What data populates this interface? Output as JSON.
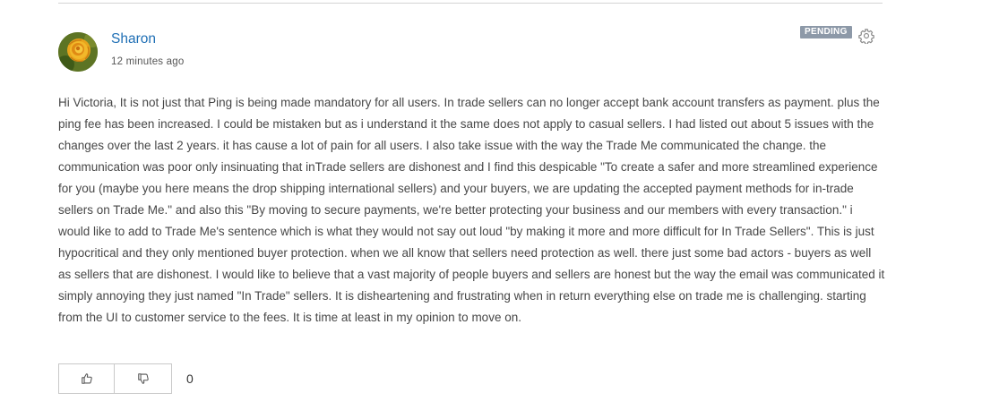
{
  "post": {
    "author": "Sharon",
    "timestamp": "12 minutes ago",
    "status": "PENDING",
    "body": "Hi Victoria, It is not just that Ping is being made mandatory for all users. In trade sellers can no longer accept bank account transfers as payment. plus the ping fee has been increased. I could be mistaken but as i understand it the same does not apply to casual sellers. I had listed out about 5 issues with the changes over the last 2 years. it has cause a lot of pain for all users. I also take issue with the way the Trade Me communicated the change. the communication was poor only insinuating that inTrade sellers are dishonest and I find this despicable \"To create a safer and more streamlined experience for you (maybe you here means the drop shipping international sellers) and your buyers, we are updating the accepted payment methods for in-trade sellers on Trade Me.\" and also this \"By moving to secure payments, we're better protecting your business and our members with every transaction.\" i would like to add to Trade Me's sentence which is what they would not say out loud \"by making it more and more difficult for In Trade Sellers\". This is just hypocritical and they only mentioned buyer protection. when we all know that sellers need protection as well. there just some bad actors - buyers as well as sellers that are dishonest. I would like to believe that a vast majority of people buyers and sellers are honest but the way the email was communicated it simply annoying they just named \"In Trade\" sellers. It is disheartening and frustrating when in return everything else on trade me is challenging. starting from the UI to customer service to the fees. It is time at least in my opinion to move on.",
    "vote_count": "0"
  },
  "icons": {
    "settings": "gear-icon",
    "upvote": "thumbs-up-icon",
    "downvote": "thumbs-down-icon",
    "avatar": "rose-flower-avatar"
  },
  "colors": {
    "author_link": "#1f6fb5",
    "badge_bg": "#8d99a8",
    "body_text": "#474747",
    "divider": "#d4d4d4"
  }
}
